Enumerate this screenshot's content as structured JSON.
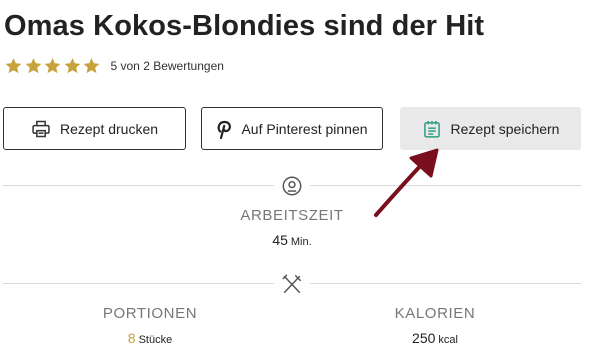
{
  "recipe": {
    "title": "Omas Kokos-Blondies sind der Hit",
    "rating": {
      "stars": 5,
      "max_stars": 5,
      "text": "5 von 2 Bewertungen",
      "star_color": "#c8a23c"
    }
  },
  "actions": {
    "print_label": "Rezept drucken",
    "pinterest_label": "Auf Pinterest pinnen",
    "save_label": "Rezept speichern",
    "save_icon_color": "#2e9e82"
  },
  "details": {
    "worktime": {
      "label": "ARBEITSZEIT",
      "value": "45",
      "unit": "Min."
    },
    "portions": {
      "label": "PORTIONEN",
      "value": "8",
      "unit": "Stücke"
    },
    "calories": {
      "label": "KALORIEN",
      "value": "250",
      "unit": "kcal"
    }
  },
  "annotation": {
    "arrow_color": "#7a0f1e"
  }
}
